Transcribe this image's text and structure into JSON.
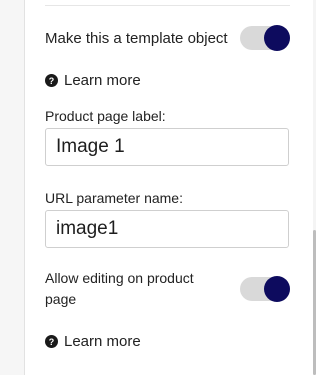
{
  "template_toggle": {
    "label": "Make this a template object",
    "on": true
  },
  "help_link_1": {
    "label": "Learn more"
  },
  "product_page_label": {
    "label": "Product page label:",
    "value": "Image 1"
  },
  "url_parameter": {
    "label": "URL parameter name:",
    "value": "image1"
  },
  "allow_editing_toggle": {
    "label": "Allow editing on product page",
    "on": true
  },
  "help_link_2": {
    "label": "Learn more"
  },
  "colors": {
    "toggle_knob": "#0d0b5e",
    "toggle_track": "#d9d9d9"
  }
}
